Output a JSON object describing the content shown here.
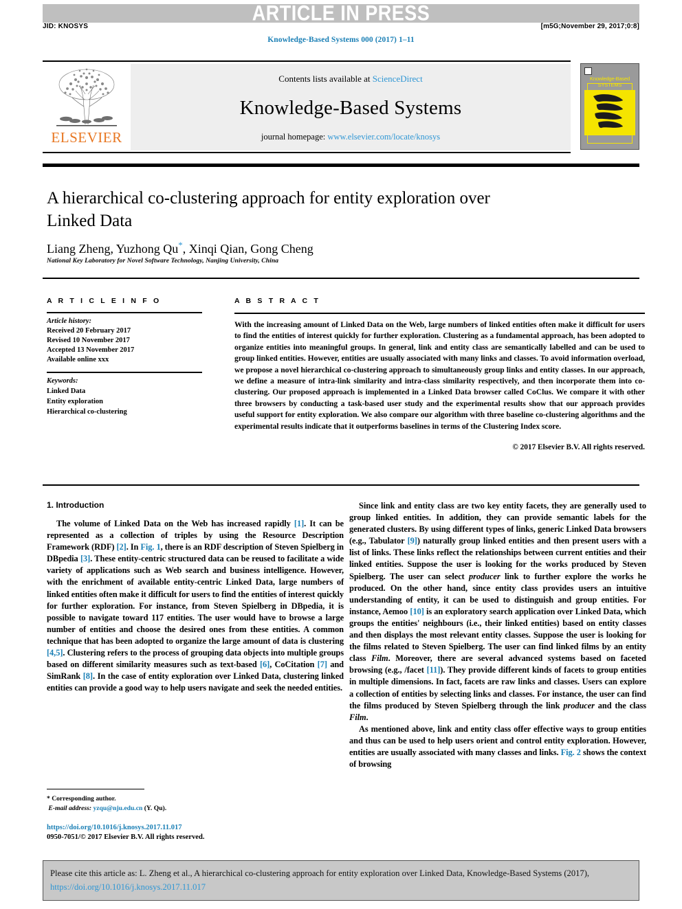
{
  "banner": {
    "text": "ARTICLE IN PRESS",
    "bg_color": "#bfbfbf"
  },
  "running_head": {
    "jid": "JID: KNOSYS",
    "stamp": "[m5G;November 29, 2017;0:8]"
  },
  "journal_reference": "Knowledge-Based Systems 000 (2017) 1–11",
  "masthead": {
    "contents_prefix": "Contents lists available at ",
    "contents_link": "ScienceDirect",
    "journal_title": "Knowledge-Based Systems",
    "homepage_prefix": "journal homepage: ",
    "homepage_link": "www.elsevier.com/locate/knosys",
    "publisher_wordmark": "ELSEVIER",
    "publisher_color": "#E87722",
    "cover_title_line1": "Knowledge-Based",
    "cover_title_line2": "SYSTEMS",
    "cover_accent_color": "#f5e400"
  },
  "article": {
    "title": "A hierarchical co-clustering approach for entity exploration over Linked Data",
    "authors": "Liang Zheng, Yuzhong Qu",
    "authors_tail": ", Xinqi Qian, Gong Cheng",
    "corresponding_marker": "*",
    "affiliation": "National Key Laboratory for Novel Software Technology, Nanjing University, China"
  },
  "article_info": {
    "heading": "A R T I C L E   I N F O",
    "history_label": "Article history:",
    "history": [
      "Received 20 February 2017",
      "Revised 10 November 2017",
      "Accepted 13 November 2017",
      "Available online xxx"
    ],
    "keywords_label": "Keywords:",
    "keywords": [
      "Linked Data",
      "Entity exploration",
      "Hierarchical co-clustering"
    ]
  },
  "abstract": {
    "heading": "A B S T R A C T",
    "text": "With the increasing amount of Linked Data on the Web, large numbers of linked entities often make it difficult for users to find the entities of interest quickly for further exploration. Clustering as a fundamental approach, has been adopted to organize entities into meaningful groups. In general, link and entity class are semantically labelled and can be used to group linked entities. However, entities are usually associated with many links and classes. To avoid information overload, we propose a novel hierarchical co-clustering approach to simultaneously group links and entity classes. In our approach, we define a measure of intra-link similarity and intra-class similarity respectively, and then incorporate them into co-clustering. Our proposed approach is implemented in a Linked Data browser called CoClus. We compare it with other three browsers by conducting a task-based user study and the experimental results show that our approach provides useful support for entity exploration. We also compare our algorithm with three baseline co-clustering algorithms and the experimental results indicate that it outperforms baselines in terms of the Clustering Index score.",
    "rights": "© 2017 Elsevier B.V. All rights reserved."
  },
  "introduction": {
    "heading": "1. Introduction",
    "left_paragraph_parts": [
      "The volume of Linked Data on the Web has increased rapidly ",
      "[1]",
      ". It can be represented as a collection of triples by using the Resource Description Framework (RDF) ",
      "[2]",
      ". In ",
      "Fig. 1",
      ", there is an RDF description of Steven Spielberg in DBpedia ",
      "[3]",
      ". These entity-centric structured data can be reused to facilitate a wide variety of applications such as Web search and business intelligence. However, with the enrichment of available entity-centric Linked Data, large numbers of linked entities often make it difficult for users to find the entities of interest quickly for further exploration. For instance, from Steven Spielberg in DBpedia, it is possible to navigate toward 117 entities. The user would have to browse a large number of entities and choose the desired ones from these entities. A common technique that has been adopted to organize the large amount of data is clustering ",
      "[4,5]",
      ". Clustering refers to the process of grouping data objects into multiple groups based on different similarity measures such as text-based ",
      "[6]",
      ", CoCitation ",
      "[7]",
      " and SimRank ",
      "[8]",
      ". In the case of entity exploration over Linked Data, clustering linked entities can provide a good way to help users navigate and seek the needed entities."
    ],
    "right_paragraph1_parts": [
      "Since link and entity class are two key entity facets, they are generally used to group linked entities. In addition, they can provide semantic labels for the generated clusters. By using different types of links, generic Linked Data browsers (e.g., Tabulator ",
      "[9]",
      ") naturally group linked entities and then present users with a list of links. These links reflect the relationships between current entities and their linked entities. Suppose the user is looking for the works produced by Steven Spielberg. The user can select ",
      "producer",
      " link to further explore the works he produced. On the other hand, since entity class provides users an intuitive understanding of entity, it can be used to distinguish and group entities. For instance, Aemoo ",
      "[10]",
      " is an exploratory search application over Linked Data, which groups the entities' neighbours (i.e., their linked entities) based on entity classes and then displays the most relevant entity classes. Suppose the user is looking for the films related to Steven Spielberg. The user can find linked films by an entity class ",
      "Film",
      ". Moreover, there are several advanced systems based on faceted browsing (e.g., /facet ",
      "[11]",
      "). They provide different kinds of facets to group entities in multiple dimensions. In fact, facets are raw links and classes. Users can explore a collection of entities by selecting links and classes. For instance, the user can find the films produced by Steven Spielberg through the link ",
      "producer",
      " and the class ",
      "Film",
      "."
    ],
    "right_paragraph2_parts": [
      "As mentioned above, link and entity class offer effective ways to group entities and thus can be used to help users orient and control entity exploration. However, entities are usually associated with many classes and links. ",
      "Fig. 2",
      " shows the context of browsing"
    ]
  },
  "footnote": {
    "corresponding_marker": "*",
    "corresponding_text": " Corresponding author.",
    "email_label": "E-mail address:",
    "email": "yzqu@nju.edu.cn",
    "email_suffix": " (Y. Qu)."
  },
  "doi_block": {
    "doi": "https://doi.org/10.1016/j.knosys.2017.11.017",
    "issn_line": "0950-7051/© 2017 Elsevier B.V. All rights reserved."
  },
  "cite_box": {
    "prefix": "Please cite this article as: L. Zheng et al., A hierarchical co-clustering approach for entity exploration over Linked Data, Knowledge-Based Systems (2017), ",
    "link": "https://doi.org/10.1016/j.knosys.2017.11.017"
  },
  "colors": {
    "link_blue": "#1a7fb5",
    "light_link_blue": "#2e96d4",
    "banner_gray": "#bfbfbf",
    "masthead_gray": "#eeeeee",
    "cite_gray": "#c8c8c8"
  }
}
